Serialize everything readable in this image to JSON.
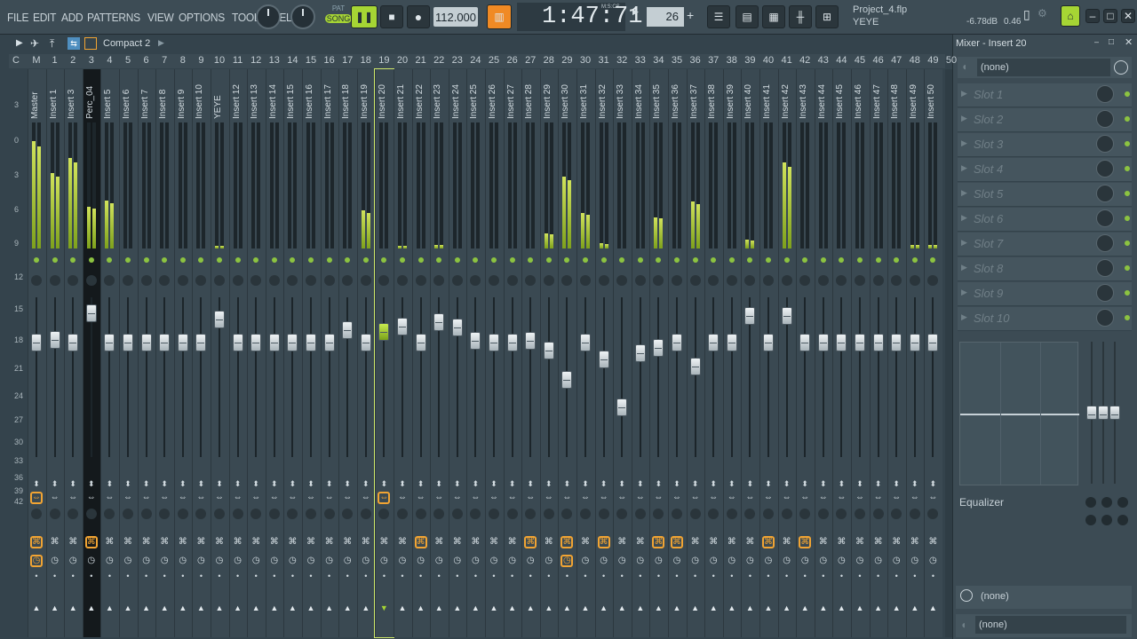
{
  "menu": [
    "FILE",
    "EDIT",
    "ADD",
    "PATTERNS",
    "VIEW",
    "OPTIONS",
    "TOOLS",
    "HELP"
  ],
  "transport": {
    "pat_label": "PAT",
    "song_label": "SONG",
    "tempo": "112.000",
    "time": "1:47:71",
    "time_unit": "M:S:CS",
    "pattern_number": "26"
  },
  "project": {
    "filename": "Project_4.flp",
    "subtitle": "YEYE",
    "volume": "-6.78dB",
    "value": "0.46"
  },
  "mixer": {
    "view_label": "Compact 2",
    "header_cells": [
      "C",
      "M",
      "1",
      "2",
      "3",
      "4",
      "5",
      "6",
      "7",
      "8",
      "9",
      "10",
      "11",
      "12",
      "13",
      "14",
      "15",
      "16",
      "17",
      "18",
      "19",
      "20",
      "21",
      "22",
      "23",
      "24",
      "25",
      "26",
      "27",
      "28",
      "29",
      "30",
      "31",
      "32",
      "33",
      "34",
      "35",
      "36",
      "37",
      "38",
      "39",
      "40",
      "41",
      "42",
      "43",
      "44",
      "45",
      "46",
      "47",
      "48",
      "49",
      "50"
    ],
    "db_scale": [
      "3",
      "0",
      "3",
      "6",
      "9",
      "12",
      "15",
      "18",
      "21",
      "24",
      "27",
      "30",
      "33",
      "36",
      "39",
      "42"
    ],
    "tracks": [
      {
        "n": "M",
        "name": "Master",
        "meter": 0.85,
        "fader": 0.27
      },
      {
        "n": "1",
        "name": "Insert 1",
        "meter": 0.6,
        "fader": 0.25
      },
      {
        "n": "3",
        "name": "Insert 3",
        "meter": 0.72,
        "fader": 0.27
      },
      {
        "n": "4",
        "name": "Perc_04",
        "meter": 0.33,
        "fader": 0.05
      },
      {
        "n": "5",
        "name": "Insert 5",
        "meter": 0.38,
        "fader": 0.27
      },
      {
        "n": "6",
        "name": "Insert 6",
        "meter": 0,
        "fader": 0.27
      },
      {
        "n": "7",
        "name": "Insert 7",
        "meter": 0,
        "fader": 0.27
      },
      {
        "n": "8",
        "name": "Insert 8",
        "meter": 0,
        "fader": 0.27
      },
      {
        "n": "9",
        "name": "Insert 9",
        "meter": 0,
        "fader": 0.27
      },
      {
        "n": "10",
        "name": "Insert 10",
        "meter": 0,
        "fader": 0.27
      },
      {
        "n": "11",
        "name": "YEYE",
        "meter": 0.02,
        "fader": 0.1
      },
      {
        "n": "12",
        "name": "Insert 12",
        "meter": 0,
        "fader": 0.27
      },
      {
        "n": "13",
        "name": "Insert 13",
        "meter": 0,
        "fader": 0.27
      },
      {
        "n": "14",
        "name": "Insert 14",
        "meter": 0,
        "fader": 0.27
      },
      {
        "n": "15",
        "name": "Insert 15",
        "meter": 0,
        "fader": 0.27
      },
      {
        "n": "16",
        "name": "Insert 16",
        "meter": 0,
        "fader": 0.27
      },
      {
        "n": "17",
        "name": "Insert 17",
        "meter": 0,
        "fader": 0.27
      },
      {
        "n": "18",
        "name": "Insert 18",
        "meter": 0,
        "fader": 0.18
      },
      {
        "n": "19",
        "name": "Insert 19",
        "meter": 0.3,
        "fader": 0.27
      },
      {
        "n": "20",
        "name": "Insert 20",
        "meter": 0,
        "fader": 0.19,
        "selected": true
      },
      {
        "n": "21",
        "name": "Insert 21",
        "meter": 0.02,
        "fader": 0.15
      },
      {
        "n": "22",
        "name": "Insert 22",
        "meter": 0,
        "fader": 0.27
      },
      {
        "n": "23",
        "name": "Insert 23",
        "meter": 0.03,
        "fader": 0.12
      },
      {
        "n": "24",
        "name": "Insert 24",
        "meter": 0,
        "fader": 0.16
      },
      {
        "n": "25",
        "name": "Insert 25",
        "meter": 0,
        "fader": 0.26
      },
      {
        "n": "26",
        "name": "Insert 26",
        "meter": 0,
        "fader": 0.27
      },
      {
        "n": "27",
        "name": "Insert 27",
        "meter": 0,
        "fader": 0.27
      },
      {
        "n": "28",
        "name": "Insert 28",
        "meter": 0,
        "fader": 0.26
      },
      {
        "n": "29",
        "name": "Insert 29",
        "meter": 0.12,
        "fader": 0.33
      },
      {
        "n": "30",
        "name": "Insert 30",
        "meter": 0.57,
        "fader": 0.55
      },
      {
        "n": "31",
        "name": "Insert 31",
        "meter": 0.28,
        "fader": 0.27
      },
      {
        "n": "32",
        "name": "Insert 32",
        "meter": 0.04,
        "fader": 0.4
      },
      {
        "n": "33",
        "name": "Insert 33",
        "meter": 0,
        "fader": 0.76
      },
      {
        "n": "34",
        "name": "Insert 34",
        "meter": 0,
        "fader": 0.35
      },
      {
        "n": "35",
        "name": "Insert 35",
        "meter": 0.25,
        "fader": 0.31
      },
      {
        "n": "36",
        "name": "Insert 36",
        "meter": 0,
        "fader": 0.27
      },
      {
        "n": "37",
        "name": "Insert 37",
        "meter": 0.37,
        "fader": 0.45
      },
      {
        "n": "38",
        "name": "Insert 38",
        "meter": 0,
        "fader": 0.27
      },
      {
        "n": "39",
        "name": "Insert 39",
        "meter": 0,
        "fader": 0.27
      },
      {
        "n": "40",
        "name": "Insert 40",
        "meter": 0.07,
        "fader": 0.07
      },
      {
        "n": "41",
        "name": "Insert 41",
        "meter": 0,
        "fader": 0.27
      },
      {
        "n": "42",
        "name": "Insert 42",
        "meter": 0.68,
        "fader": 0.07
      },
      {
        "n": "43",
        "name": "Insert 43",
        "meter": 0,
        "fader": 0.27
      },
      {
        "n": "44",
        "name": "Insert 44",
        "meter": 0,
        "fader": 0.27
      },
      {
        "n": "45",
        "name": "Insert 45",
        "meter": 0,
        "fader": 0.27
      },
      {
        "n": "46",
        "name": "Insert 46",
        "meter": 0,
        "fader": 0.27
      },
      {
        "n": "47",
        "name": "Insert 47",
        "meter": 0,
        "fader": 0.27
      },
      {
        "n": "48",
        "name": "Insert 48",
        "meter": 0,
        "fader": 0.27
      },
      {
        "n": "49",
        "name": "Insert 49",
        "meter": 0.03,
        "fader": 0.27
      },
      {
        "n": "50",
        "name": "Insert 50",
        "meter": 0.03,
        "fader": 0.27
      }
    ]
  },
  "insert_panel": {
    "title": "Mixer - Insert 20",
    "input": "(none)",
    "slots": [
      "Slot 1",
      "Slot 2",
      "Slot 3",
      "Slot 4",
      "Slot 5",
      "Slot 6",
      "Slot 7",
      "Slot 8",
      "Slot 9",
      "Slot 10"
    ],
    "eq_label": "Equalizer",
    "output_1": "(none)",
    "output_2": "(none)"
  },
  "colors": {
    "accent": "#f1a433",
    "meter": "#b7d13c",
    "led": "#8cc341"
  }
}
